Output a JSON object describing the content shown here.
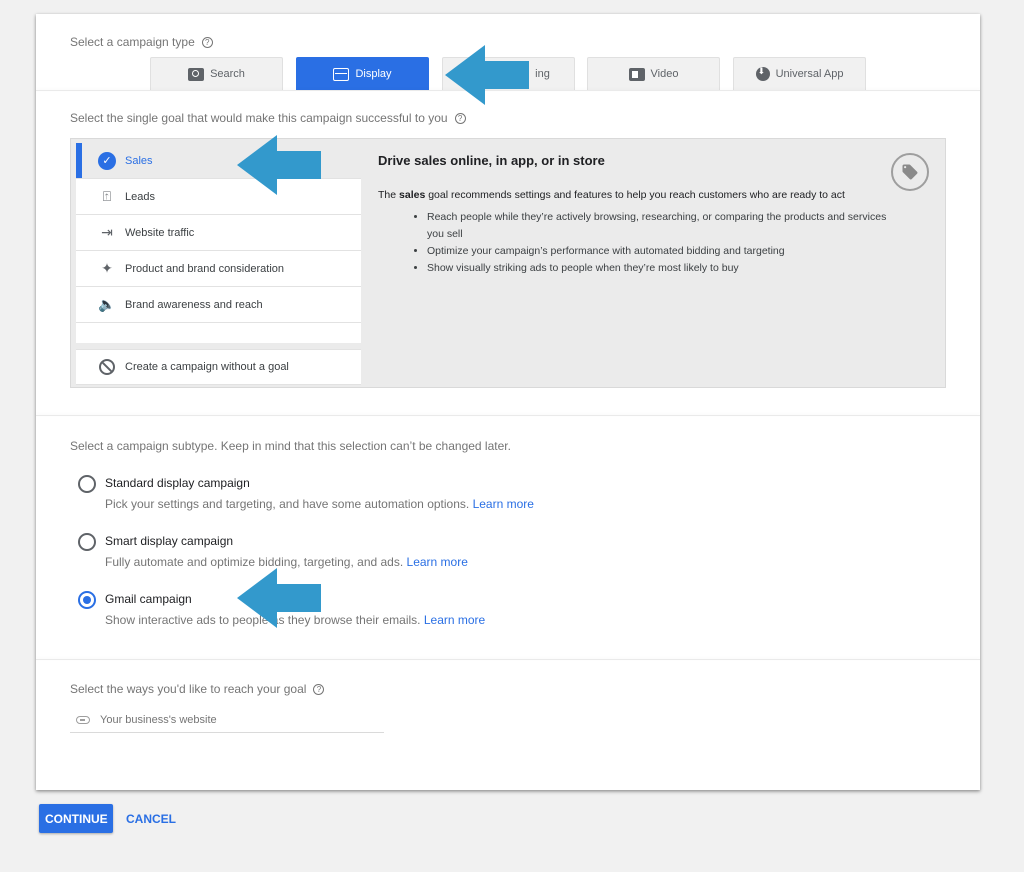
{
  "campaign_type": {
    "label": "Select a campaign type",
    "help_icon": "?",
    "tabs": [
      {
        "label": "Search",
        "icon": "search-icon",
        "active": false
      },
      {
        "label": "Display",
        "icon": "display-icon",
        "active": true
      },
      {
        "label": "ing",
        "icon": "shopping-icon",
        "active": false
      },
      {
        "label": "Video",
        "icon": "video-icon",
        "active": false
      },
      {
        "label": "Universal App",
        "icon": "app-download-icon",
        "active": false
      }
    ]
  },
  "goal": {
    "label": "Select the single goal that would make this campaign successful to you",
    "help_icon": "?",
    "items": [
      {
        "label": "Sales",
        "icon": "check-circle-icon",
        "active": true
      },
      {
        "label": "Leads",
        "icon": "leads-icon"
      },
      {
        "label": "Website traffic",
        "icon": "website-traffic-icon"
      },
      {
        "label": "Product and brand consideration",
        "icon": "sparkle-icon"
      },
      {
        "label": "Brand awareness and reach",
        "icon": "speaker-icon"
      }
    ],
    "no_goal_label": "Create a campaign without a goal",
    "detail": {
      "title": "Drive sales online, in app, or in store",
      "desc_prefix": "The ",
      "desc_bold": "sales",
      "desc_suffix": " goal recommends settings and features to help you reach customers who are ready to act",
      "bullets": [
        "Reach people while they’re actively browsing, researching, or comparing the products and services you sell",
        "Optimize your campaign’s performance with automated bidding and targeting",
        "Show visually striking ads to people when they’re most likely to buy"
      ],
      "icon": "tag-icon"
    }
  },
  "subtype": {
    "label": "Select a campaign subtype. Keep in mind that this selection can’t be changed later.",
    "options": [
      {
        "title": "Standard display campaign",
        "desc": "Pick your settings and targeting, and have some automation options.",
        "link": "Learn more",
        "checked": false
      },
      {
        "title": "Smart display campaign",
        "desc": "Fully automate and optimize bidding, targeting, and ads.",
        "link": "Learn more",
        "checked": false
      },
      {
        "title": "Gmail campaign",
        "desc": "Show interactive ads to people as they browse their emails.",
        "link": "Learn more",
        "checked": true
      }
    ]
  },
  "reach": {
    "label": "Select the ways you'd like to reach your goal",
    "help_icon": "?",
    "website_placeholder": "Your business's website"
  },
  "actions": {
    "continue": "CONTINUE",
    "cancel": "CANCEL"
  },
  "colors": {
    "accent": "#2a6fe4",
    "annotation_arrow": "#3399cc"
  }
}
